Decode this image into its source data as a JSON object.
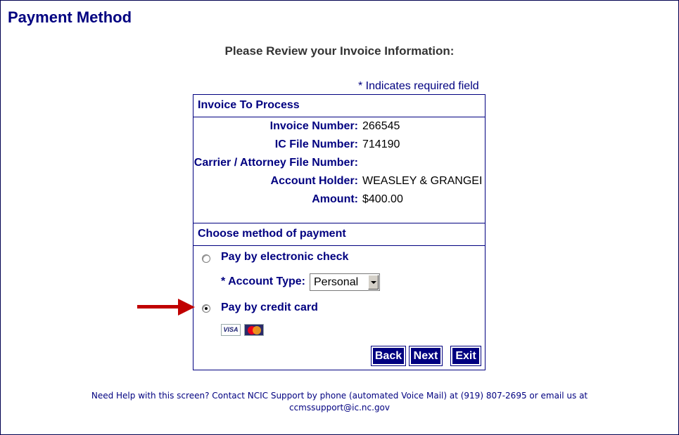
{
  "page": {
    "title": "Payment Method",
    "subtitle": "Please Review your Invoice Information:",
    "required_note": "* Indicates required field"
  },
  "invoice": {
    "heading": "Invoice To Process",
    "fields": [
      {
        "label": "Invoice Number",
        "value": "266545"
      },
      {
        "label": "IC File Number",
        "value": "714190"
      },
      {
        "label": "Carrier / Attorney File Number",
        "value": ""
      },
      {
        "label": "Account Holder",
        "value": "WEASLEY & GRANGEI"
      },
      {
        "label": "Amount",
        "value": "$400.00"
      }
    ]
  },
  "payment": {
    "heading": "Choose method of payment",
    "options": [
      {
        "label": "Pay by electronic check",
        "selected": false
      },
      {
        "label": "Pay by credit card",
        "selected": true
      }
    ],
    "account_type_label": "* Account Type:",
    "account_type_value": "Personal",
    "cards": [
      "VISA",
      "MasterCard"
    ]
  },
  "buttons": {
    "back": "Back",
    "next": "Next",
    "exit": "Exit"
  },
  "footer": {
    "line1": "Need Help with this screen? Contact NCIC Support by phone (automated Voice Mail) at (919) 807-2695 or email us at",
    "line2": "ccmssupport@ic.nc.gov"
  },
  "colors": {
    "brand_navy": "#000080",
    "arrow_red": "#c00000"
  }
}
